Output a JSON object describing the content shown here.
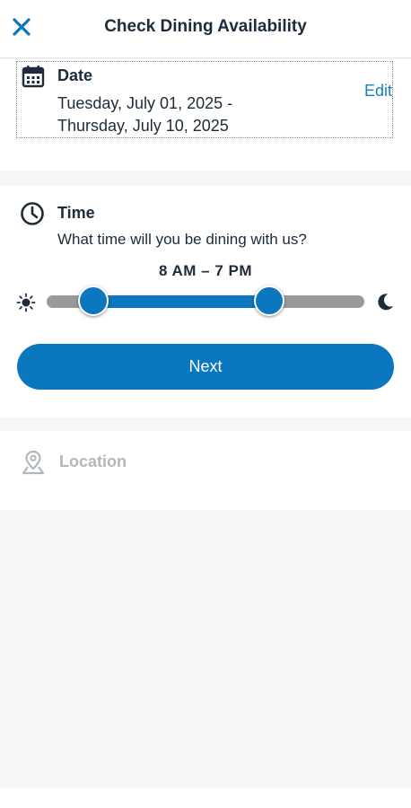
{
  "header": {
    "title": "Check Dining Availability",
    "close_icon": "close-icon"
  },
  "date_section": {
    "label": "Date",
    "icon": "calendar-icon",
    "range_line1": "Tuesday, July 01, 2025 -",
    "range_line2": "Thursday, July 10, 2025",
    "edit_label": "Edit"
  },
  "time_section": {
    "label": "Time",
    "icon": "clock-icon",
    "question": "What time will you be dining with us?",
    "range_text": "8 AM  –  7 PM",
    "slider": {
      "low_fraction": 0.147,
      "high_fraction": 0.7,
      "start_icon": "sun-icon",
      "end_icon": "moon-icon"
    },
    "next_label": "Next"
  },
  "location_section": {
    "label": "Location",
    "icon": "map-pin-icon"
  },
  "colors": {
    "accent": "#0b77bf",
    "link": "#1a7fbd",
    "text": "#1d2b3a",
    "disabled": "#b2b7bb",
    "track": "#9a9a9a",
    "background": "#f5f7f7"
  }
}
